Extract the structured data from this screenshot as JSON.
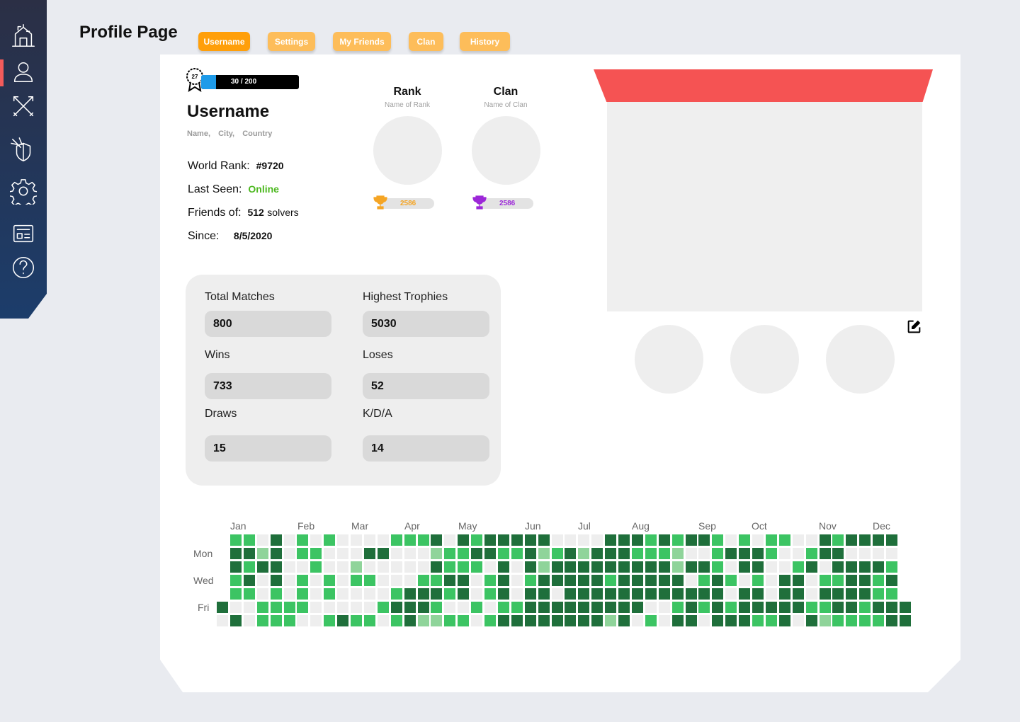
{
  "page": {
    "title": "Profile Page"
  },
  "sidebar": {
    "items": [
      {
        "icon": "home-icon",
        "active": false
      },
      {
        "icon": "user-icon",
        "active": true
      },
      {
        "icon": "crossed-swords-icon",
        "active": false
      },
      {
        "icon": "shield-arrows-icon",
        "active": false
      },
      {
        "icon": "gear-icon",
        "active": false
      },
      {
        "icon": "newspaper-icon",
        "active": false
      },
      {
        "icon": "help-icon",
        "active": false
      }
    ],
    "accent_color": "#f35b5b"
  },
  "tabs": [
    {
      "label": "Username",
      "active": true
    },
    {
      "label": "Settings",
      "active": false
    },
    {
      "label": "My Friends",
      "active": false
    },
    {
      "label": "Clan",
      "active": false
    },
    {
      "label": "History",
      "active": false
    }
  ],
  "profile": {
    "level": "27",
    "xp_text": "30 / 200",
    "xp_fraction": 0.15,
    "username": "Username",
    "location": [
      "Name,",
      "City,",
      "Country"
    ],
    "world_rank_label": "World Rank:",
    "world_rank": "#9720",
    "last_seen_label": "Last Seen:",
    "last_seen": "Online",
    "friends_label": "Friends of:",
    "friends_count": "512",
    "friends_unit": "solvers",
    "since_label": "Since:",
    "since": "8/5/2020"
  },
  "rank": {
    "title": "Rank",
    "subtitle": "Name of Rank",
    "trophies": "2586",
    "trophy_color": "#f5a524"
  },
  "clan": {
    "title": "Clan",
    "subtitle": "Name of Clan",
    "trophies": "2586",
    "trophy_color": "#9c27d8"
  },
  "stats": {
    "total_matches_label": "Total Matches",
    "total_matches": "800",
    "highest_trophies_label": "Highest Trophies",
    "highest_trophies": "5030",
    "wins_label": "Wins",
    "wins": "733",
    "loses_label": "Loses",
    "loses": "52",
    "draws_label": "Draws",
    "draws": "15",
    "kda_label": "K/D/A",
    "kda": "14"
  },
  "banner": {
    "color": "#f55353"
  },
  "activity": {
    "months": [
      "Jan",
      "Feb",
      "Mar",
      "Apr",
      "May",
      "Jun",
      "Jul",
      "Aug",
      "Sep",
      "Oct",
      "Nov",
      "Dec"
    ],
    "day_labels": [
      "Mon",
      "Wed",
      "Fri"
    ],
    "colors": [
      "#eeeeee",
      "#8fd49a",
      "#3cc463",
      "#1f6f3b"
    ],
    "rows": [
      "-22030202000022230323333300003332323320202200323333",
      "-33130220003300012233223123133322210023332002330000",
      "-32330020010000032220303133333333313320330023033332",
      "-23030202022000223302302333332333330232020330223323",
      "-22020202000023332302303303333333333330330330333322",
      "3002222000002333200202233333333300232323333322332333",
      "0302220023220231122023333333313020330333223031222233"
    ]
  }
}
